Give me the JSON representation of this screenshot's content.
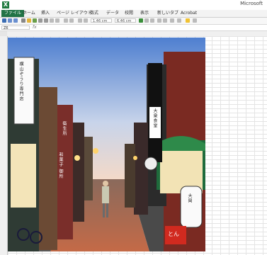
{
  "window": {
    "app_name": "Microsoft"
  },
  "ribbon": {
    "tabs": [
      {
        "label": "ファイル"
      },
      {
        "label": "ホーム"
      },
      {
        "label": "挿入"
      },
      {
        "label": "ページ レイアウト"
      },
      {
        "label": "数式"
      },
      {
        "label": "データ"
      },
      {
        "label": "校閲"
      },
      {
        "label": "表示"
      },
      {
        "label": "新しいタブ"
      },
      {
        "label": "Acrobat"
      }
    ]
  },
  "toolbar": {
    "height_field": "1.46 cm",
    "width_field": "6.46 cm"
  },
  "formula_bar": {
    "name_box": "Z6",
    "fx": "fx"
  },
  "picture": {
    "signs": {
      "left_big": "横山ぞうり専門店",
      "left_small": "衛生所",
      "left_lower": "和菓子 御所",
      "right_tall": "大衆食堂",
      "right_round": "大岡",
      "corner_red": "とん"
    }
  }
}
